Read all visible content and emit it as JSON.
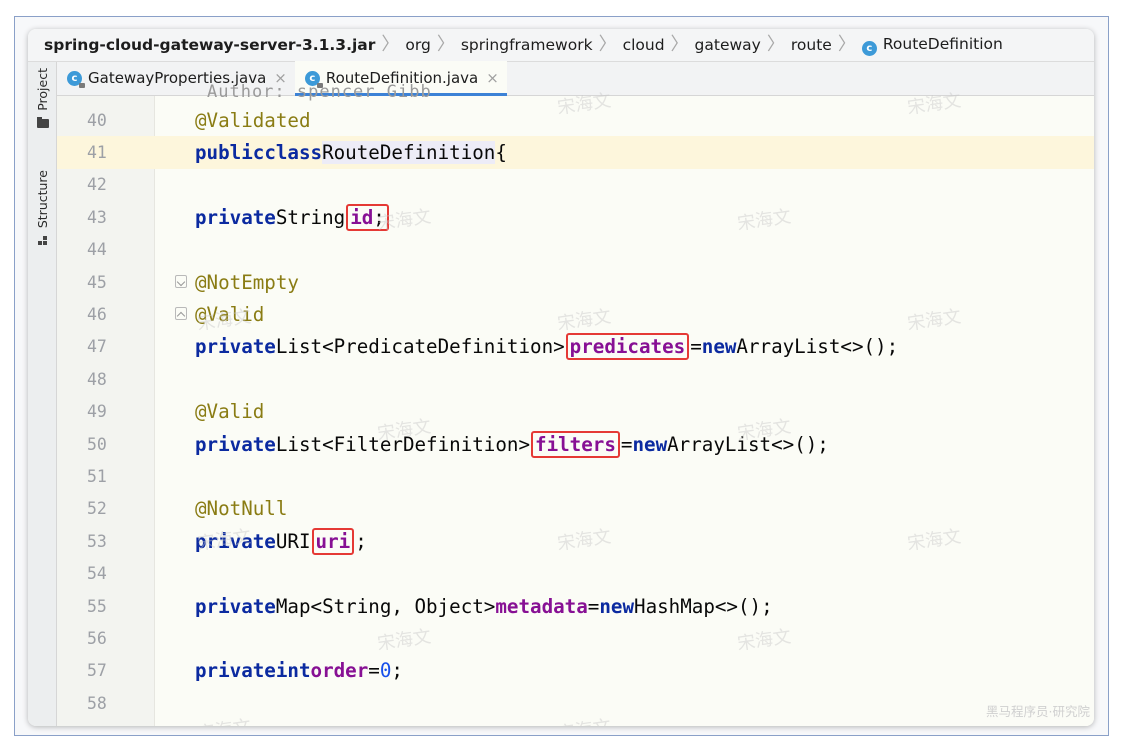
{
  "breadcrumb": {
    "items": [
      "spring-cloud-gateway-server-3.1.3.jar",
      "org",
      "springframework",
      "cloud",
      "gateway",
      "route",
      "RouteDefinition"
    ]
  },
  "tool_windows": {
    "project": "Project",
    "structure": "Structure"
  },
  "tabs": [
    {
      "label": "GatewayProperties.java",
      "active": false
    },
    {
      "label": "RouteDefinition.java",
      "active": true
    }
  ],
  "editor": {
    "clipped_line_text": "Author: spencer Gibb",
    "current_line": 41,
    "lines": [
      {
        "num": "40",
        "text": "@Validated"
      },
      {
        "num": "41",
        "text": "public class RouteDefinition {"
      },
      {
        "num": "42",
        "text": ""
      },
      {
        "num": "43",
        "text": "    private String id;"
      },
      {
        "num": "44",
        "text": ""
      },
      {
        "num": "45",
        "text": "    @NotEmpty"
      },
      {
        "num": "46",
        "text": "    @Valid"
      },
      {
        "num": "47",
        "text": "    private List<PredicateDefinition> predicates = new ArrayList<>();"
      },
      {
        "num": "48",
        "text": ""
      },
      {
        "num": "49",
        "text": "    @Valid"
      },
      {
        "num": "50",
        "text": "    private List<FilterDefinition> filters = new ArrayList<>();"
      },
      {
        "num": "51",
        "text": ""
      },
      {
        "num": "52",
        "text": "    @NotNull"
      },
      {
        "num": "53",
        "text": "    private URI uri;"
      },
      {
        "num": "54",
        "text": ""
      },
      {
        "num": "55",
        "text": "    private Map<String, Object> metadata = new HashMap<>();"
      },
      {
        "num": "56",
        "text": ""
      },
      {
        "num": "57",
        "text": "    private int order = 0;"
      },
      {
        "num": "58",
        "text": ""
      }
    ],
    "tokens": {
      "validated": "@Validated",
      "public": "public",
      "class": "class",
      "class_name": "RouteDefinition",
      "brace": "{",
      "private": "private",
      "string": "String",
      "id": "id",
      "semicolon": ";",
      "not_empty": "@NotEmpty",
      "valid": "@Valid",
      "list_predicate": "List<PredicateDefinition>",
      "predicates": "predicates",
      "equals": "=",
      "new": "new",
      "arraylist": "ArrayList<>();",
      "list_filter": "List<FilterDefinition>",
      "filters": "filters",
      "not_null": "@NotNull",
      "uri_type": "URI",
      "uri": "uri",
      "map_type": "Map<String, Object>",
      "metadata": "metadata",
      "hashmap": "HashMap<>();",
      "int": "int",
      "order": "order",
      "zero": "0"
    }
  },
  "watermark": {
    "text": "宋海文",
    "footer": "黑马程序员·研究院"
  },
  "colors": {
    "keyword": "#0b2aa0",
    "annotation": "#8a7c14",
    "field": "#871094",
    "number": "#1750eb",
    "highlight_box": "#e53935"
  }
}
